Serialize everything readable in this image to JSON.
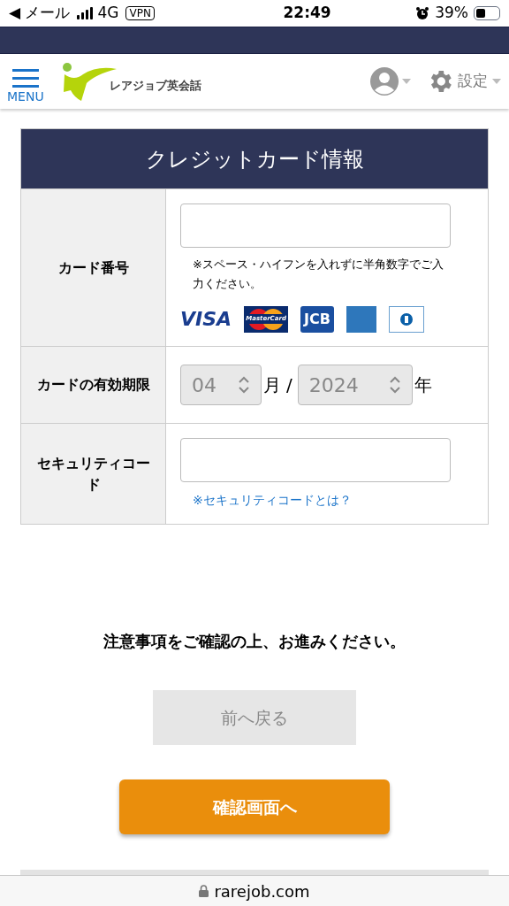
{
  "status_bar": {
    "back": "◀ メール",
    "network": "4G",
    "vpn": "VPN",
    "time": "22:49",
    "battery": "39%"
  },
  "header": {
    "menu": "MENU",
    "logo": "レアジョブ英会話",
    "settings": "設定"
  },
  "form": {
    "title": "クレジットカード情報",
    "rows": [
      {
        "kind": "card",
        "label": "カード番号",
        "note": "※スペース・ハイフンを入れずに半角数字でご入力ください。",
        "brands": [
          {
            "kind": "visa",
            "label": "VISA"
          },
          {
            "kind": "master",
            "label": "MasterCard"
          },
          {
            "kind": "jcb",
            "label": "JCB"
          },
          {
            "kind": "amex"
          },
          {
            "kind": "diners"
          }
        ]
      },
      {
        "kind": "expiry",
        "label": "カードの有効期限",
        "month": "04",
        "month_unit": "月",
        "separator": "/",
        "year": "2024",
        "year_unit": "年"
      },
      {
        "kind": "security",
        "label": "セキュリティコード",
        "link": "※セキュリティコードとは？"
      }
    ]
  },
  "notice": "注意事項をご確認の上、お進みください。",
  "back_button": {
    "label": "前へ戻る",
    "disabled": true
  },
  "confirm_button": {
    "label": "確認画面へ"
  },
  "url_bar": {
    "domain": "rarejob.com"
  }
}
